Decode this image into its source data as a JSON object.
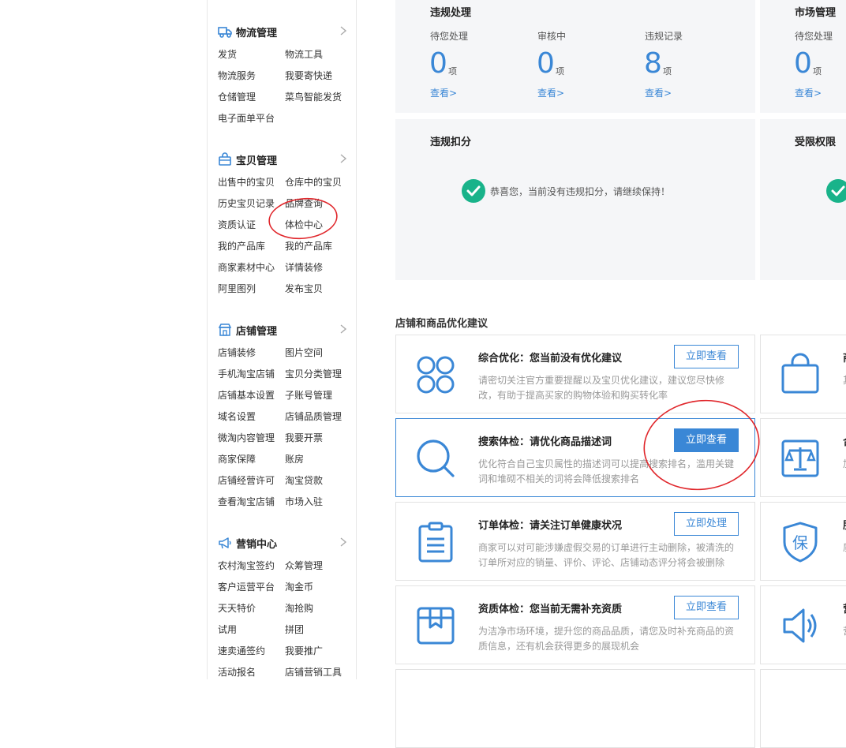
{
  "sidebar": {
    "sections": [
      {
        "title": "物流管理",
        "icon": "truck-icon",
        "items": [
          "发货",
          "物流工具",
          "物流服务",
          "我要寄快递",
          "仓储管理",
          "菜鸟智能发货",
          "电子面单平台"
        ]
      },
      {
        "title": "宝贝管理",
        "icon": "bag-icon",
        "items": [
          "出售中的宝贝",
          "仓库中的宝贝",
          "历史宝贝记录",
          "品牌查询",
          "资质认证",
          "体检中心",
          "我的产品库",
          "我的产品库",
          "商家素材中心",
          "详情装修",
          "阿里图列",
          "发布宝贝"
        ]
      },
      {
        "title": "店铺管理",
        "icon": "store-icon",
        "items": [
          "店铺装修",
          "图片空间",
          "手机淘宝店铺",
          "宝贝分类管理",
          "店铺基本设置",
          "子账号管理",
          "域名设置",
          "店铺品质管理",
          "微淘内容管理",
          "我要开票",
          "商家保障",
          "账房",
          "店铺经营许可",
          "淘宝贷款",
          "查看淘宝店铺",
          "市场入驻"
        ]
      },
      {
        "title": "营销中心",
        "icon": "megaphone-icon",
        "items": [
          "农村淘宝签约",
          "众筹管理",
          "客户运营平台",
          "淘金币",
          "天天特价",
          "淘抢购",
          "试用",
          "拼团",
          "速卖通签约",
          "我要推广",
          "活动报名",
          "店铺营销工具"
        ]
      }
    ]
  },
  "violations": {
    "title": "违规处理",
    "stats": [
      {
        "label": "待您处理",
        "value": "0",
        "unit": "项",
        "link": "查看>"
      },
      {
        "label": "审核中",
        "value": "0",
        "unit": "项",
        "link": "查看>"
      },
      {
        "label": "违规记录",
        "value": "8",
        "unit": "项",
        "link": "查看>"
      }
    ]
  },
  "market": {
    "title": "市场管理",
    "stats": [
      {
        "label": "待您处理",
        "value": "0",
        "unit": "项",
        "link": "查看>"
      }
    ]
  },
  "deduction": {
    "title": "违规扣分",
    "message": "恭喜您，当前没有违规扣分，请继续保持！"
  },
  "restriction": {
    "title": "受限权限"
  },
  "optimization": {
    "title": "店铺和商品优化建议",
    "items": [
      {
        "icon": "grid-circles-icon",
        "title": "综合优化：您当前没有优化建议",
        "desc": "请密切关注官方重要提醒以及宝贝优化建议，建议您尽快修改，有助于提高买家的购物体验和购买转化率",
        "button": "立即查看",
        "primary": false
      },
      {
        "icon": "search-icon",
        "title": "搜索体检：请优化商品描述词",
        "desc": "优化符合自己宝贝属性的描述词可以提高搜索排名，滥用关键词和堆砌不相关的词将会降低搜索排名",
        "button": "立即查看",
        "primary": true
      },
      {
        "icon": "clipboard-icon",
        "title": "订单体检：请关注订单健康状况",
        "desc": "商家可以对可能涉嫌虚假交易的订单进行主动删除，被清洗的订单所对应的销量、评价、评论、店铺动态评分将会被删除",
        "button": "立即处理",
        "primary": false
      },
      {
        "icon": "box-icon",
        "title": "资质体检：您当前无需补充资质",
        "desc": "为洁净市场环境，提升您的商品品质，请您及时补充商品的资质信息，还有机会获得更多的展现机会",
        "button": "立即查看",
        "primary": false
      }
    ],
    "right_items": [
      {
        "icon": "shopping-bag-icon",
        "title": "商",
        "desc": "其"
      },
      {
        "icon": "scale-icon",
        "title": "合",
        "desc": "加"
      },
      {
        "icon": "shield-bao-icon",
        "title": "服",
        "desc": "质"
      },
      {
        "icon": "speaker-icon",
        "title": "营",
        "desc": "营"
      }
    ]
  },
  "colors": {
    "accent": "#3a87d6",
    "success": "#19b38a",
    "annotation": "#e0262b"
  }
}
